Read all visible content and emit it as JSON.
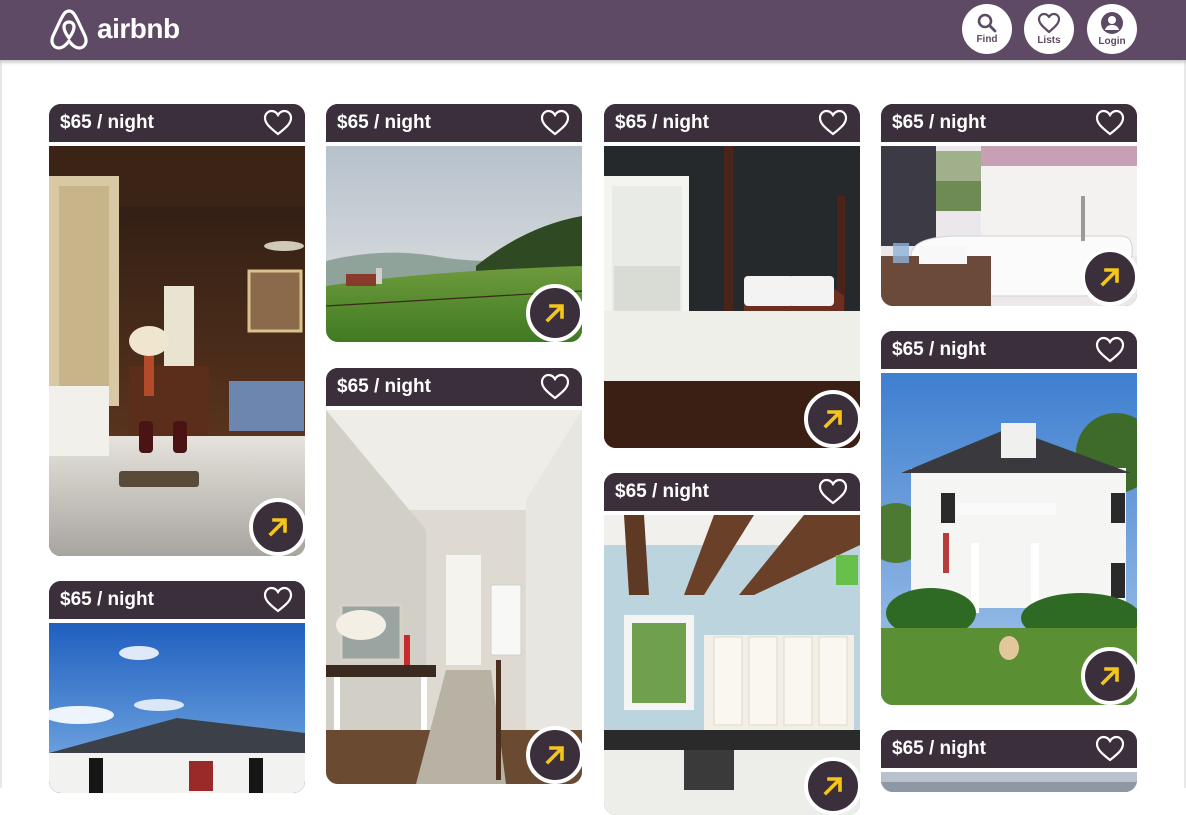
{
  "header": {
    "brand": "airbnb",
    "nav": [
      {
        "label": "Find",
        "icon": "search-icon"
      },
      {
        "label": "Lists",
        "icon": "heart-icon"
      },
      {
        "label": "Login",
        "icon": "user-icon"
      }
    ]
  },
  "colors": {
    "brand": "#5e4a64",
    "card": "#3a2f3b",
    "accent": "#f5c518"
  },
  "listings": [
    {
      "price": "$65 / night",
      "photo": "bedroom-with-wine-glasses"
    },
    {
      "price": "$65 / night",
      "photo": "green-pasture-landscape"
    },
    {
      "price": "$65 / night",
      "photo": "four-poster-bed"
    },
    {
      "price": "$65 / night",
      "photo": "bathroom-with-tub"
    },
    {
      "price": "$65 / night",
      "photo": "white-colonial-house"
    },
    {
      "price": "$65 / night",
      "photo": "hallway-with-staircase"
    },
    {
      "price": "$65 / night",
      "photo": "kitchen-with-beams"
    },
    {
      "price": "$65 / night",
      "photo": "house-exterior-sky"
    },
    {
      "price": "$65 / night",
      "photo": "landscape-partial"
    }
  ]
}
